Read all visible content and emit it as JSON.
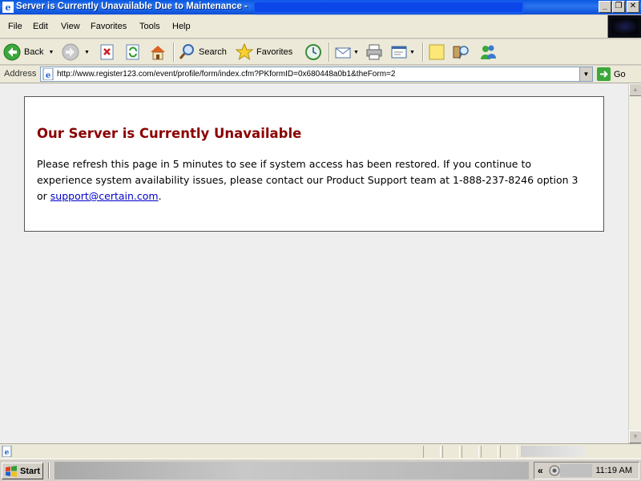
{
  "window": {
    "title": "Server is Currently Unavailable Due to Maintenance - ",
    "buttons": {
      "minimize": "_",
      "maximize": "❐",
      "close": "✕"
    }
  },
  "menu": {
    "items": [
      "File",
      "Edit",
      "View",
      "Favorites",
      "Tools",
      "Help"
    ]
  },
  "toolbar": {
    "back_label": "Back",
    "search_label": "Search",
    "favorites_label": "Favorites"
  },
  "address": {
    "label": "Address",
    "url": "http://www.register123.com/event/profile/form/index.cfm?PKformID=0x680448a0b1&theForm=2",
    "go_label": "Go"
  },
  "page": {
    "heading": "Our Server is Currently Unavailable",
    "message_before_link": "Please refresh this page in 5 minutes to see if system access has been restored. If you continue to experience system availability issues, please contact our Product Support team at 1-888-237-8246 option 3 or ",
    "support_email": "support@certain.com",
    "message_after_link": "."
  },
  "taskbar": {
    "start_label": "Start",
    "tray_chevron": "«",
    "clock": "11:19 AM"
  },
  "colors": {
    "heading": "#8b0000",
    "link": "#0000cc",
    "titlebar": "#0a58e0"
  }
}
